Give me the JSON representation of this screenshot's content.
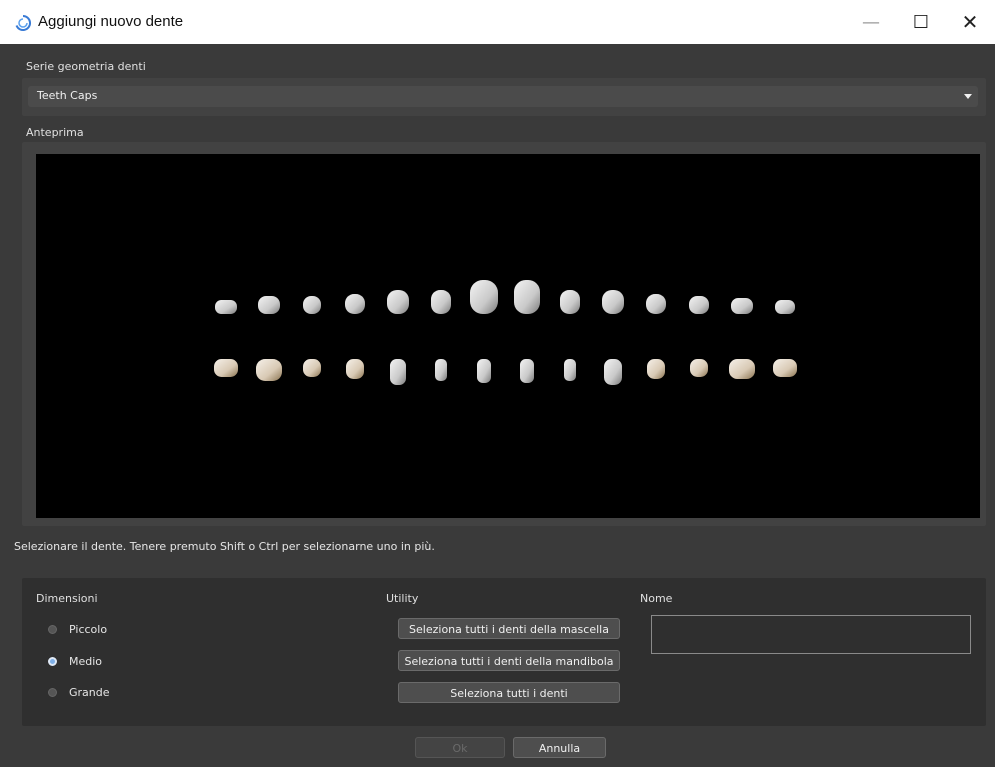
{
  "window": {
    "title": "Aggiungi nuovo dente",
    "minimize_glyph": "—",
    "maximize_glyph": "☐",
    "close_glyph": "✕"
  },
  "series": {
    "label": "Serie geometria denti",
    "selected": "Teeth Caps"
  },
  "preview": {
    "label": "Anteprima",
    "upper_teeth_count": 14,
    "lower_teeth_count": 14
  },
  "hint": "Selezionare il dente. Tenere premuto Shift o Ctrl per selezionarne uno in più.",
  "dimensions": {
    "label": "Dimensioni",
    "options": [
      "Piccolo",
      "Medio",
      "Grande"
    ],
    "selected": "Medio"
  },
  "utility": {
    "label": "Utility",
    "buttons": [
      "Seleziona tutti i denti della mascella",
      "Seleziona tutti i denti della mandibola",
      "Seleziona tutti i denti"
    ]
  },
  "name": {
    "label": "Nome",
    "value": ""
  },
  "footer": {
    "ok_label": "Ok",
    "cancel_label": "Annulla"
  },
  "colors": {
    "background": "#3a3a3a",
    "panel": "#424242",
    "viewport": "#000000",
    "radio_selected": "#7fb0e8"
  }
}
